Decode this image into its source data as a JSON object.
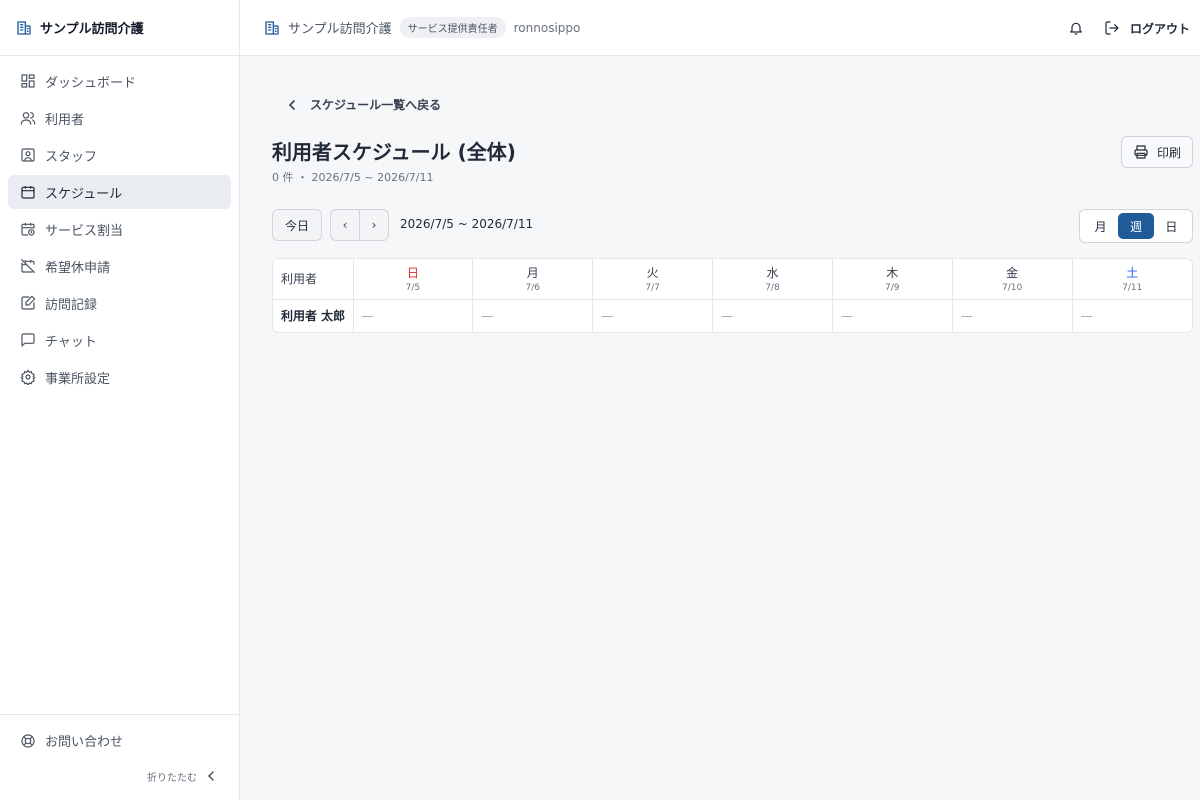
{
  "app": {
    "name": "サンプル訪問介護"
  },
  "sidebar": {
    "items": [
      {
        "label": "ダッシュボード",
        "icon": "dashboard-icon"
      },
      {
        "label": "利用者",
        "icon": "users-icon"
      },
      {
        "label": "スタッフ",
        "icon": "staff-icon"
      },
      {
        "label": "スケジュール",
        "icon": "calendar-icon",
        "active": true
      },
      {
        "label": "サービス割当",
        "icon": "calendar-clock-icon"
      },
      {
        "label": "希望休申請",
        "icon": "calendar-off-icon"
      },
      {
        "label": "訪問記録",
        "icon": "record-edit-icon"
      },
      {
        "label": "チャット",
        "icon": "chat-icon"
      },
      {
        "label": "事業所設定",
        "icon": "gear-icon"
      }
    ],
    "contact_label": "お問い合わせ",
    "collapse_label": "折りたたむ"
  },
  "header": {
    "office": "サンプル訪問介護",
    "role": "サービス提供責任者",
    "username": "ronnosippo",
    "logout_label": "ログアウト"
  },
  "main": {
    "back_label": "スケジュール一覧へ戻る",
    "title": "利用者スケジュール (全体)",
    "subtitle": "0 件 ・ 2026/7/5 ~ 2026/7/11",
    "print_label": "印刷",
    "today_label": "今日",
    "prev_label": "‹",
    "next_label": "›",
    "range": "2026/7/5 ~ 2026/7/11",
    "views": [
      "月",
      "週",
      "日"
    ],
    "active_view": "週"
  },
  "table": {
    "user_header": "利用者",
    "days": [
      {
        "name": "日",
        "date": "7/5"
      },
      {
        "name": "月",
        "date": "7/6"
      },
      {
        "name": "火",
        "date": "7/7"
      },
      {
        "name": "水",
        "date": "7/8"
      },
      {
        "name": "木",
        "date": "7/9"
      },
      {
        "name": "金",
        "date": "7/10"
      },
      {
        "name": "土",
        "date": "7/11"
      }
    ],
    "rows": [
      {
        "user": "利用者 太郎",
        "cells": [
          "—",
          "—",
          "—",
          "—",
          "—",
          "—",
          "—"
        ]
      }
    ]
  },
  "colors": {
    "accent": "#1f5a99",
    "sunday": "#dc2626",
    "saturday": "#2563eb"
  }
}
